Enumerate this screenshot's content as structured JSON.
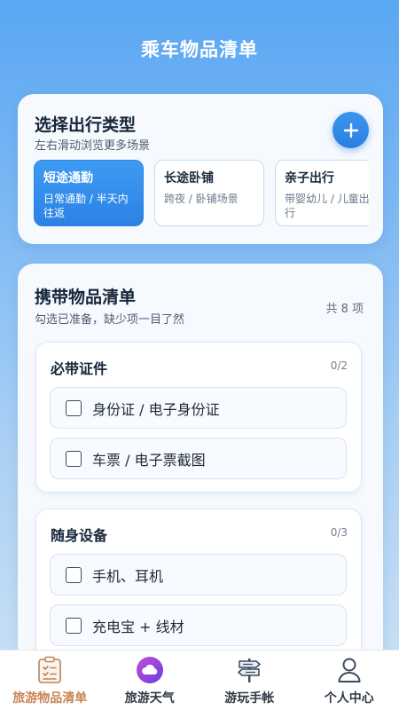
{
  "app": {
    "title": "乘车物品清单"
  },
  "trip_type": {
    "title": "选择出行类型",
    "subtitle": "左右滑动浏览更多场景",
    "add_label": "+",
    "options": [
      {
        "name": "短途通勤",
        "desc": "日常通勤 / 半天内往返",
        "active": true
      },
      {
        "name": "长途卧铺",
        "desc": "跨夜 / 卧铺场景",
        "active": false
      },
      {
        "name": "亲子出行",
        "desc": "带婴幼儿 / 儿童出行",
        "active": false
      }
    ]
  },
  "checklist": {
    "title": "携带物品清单",
    "subtitle": "勾选已准备，缺少项一目了然",
    "total": "共 8 项",
    "groups": [
      {
        "title": "必带证件",
        "progress": "0/2",
        "items": [
          {
            "label": "身份证 / 电子身份证",
            "checked": false
          },
          {
            "label": "车票 / 电子票截图",
            "checked": false
          }
        ]
      },
      {
        "title": "随身设备",
        "progress": "0/3",
        "items": [
          {
            "label": "手机、耳机",
            "checked": false
          },
          {
            "label": "充电宝 + 线材",
            "checked": false
          }
        ]
      }
    ]
  },
  "tabbar": {
    "tabs": [
      {
        "label": "旅游物品清单",
        "icon": "checklist-icon",
        "active": true
      },
      {
        "label": "旅游天气",
        "icon": "weather-icon",
        "active": false
      },
      {
        "label": "游玩手帐",
        "icon": "signpost-icon",
        "active": false
      },
      {
        "label": "个人中心",
        "icon": "user-icon",
        "active": false
      }
    ]
  },
  "colors": {
    "accent": "#2b82e4",
    "active_tab": "#c98452",
    "background_top": "#5aa7f3"
  }
}
